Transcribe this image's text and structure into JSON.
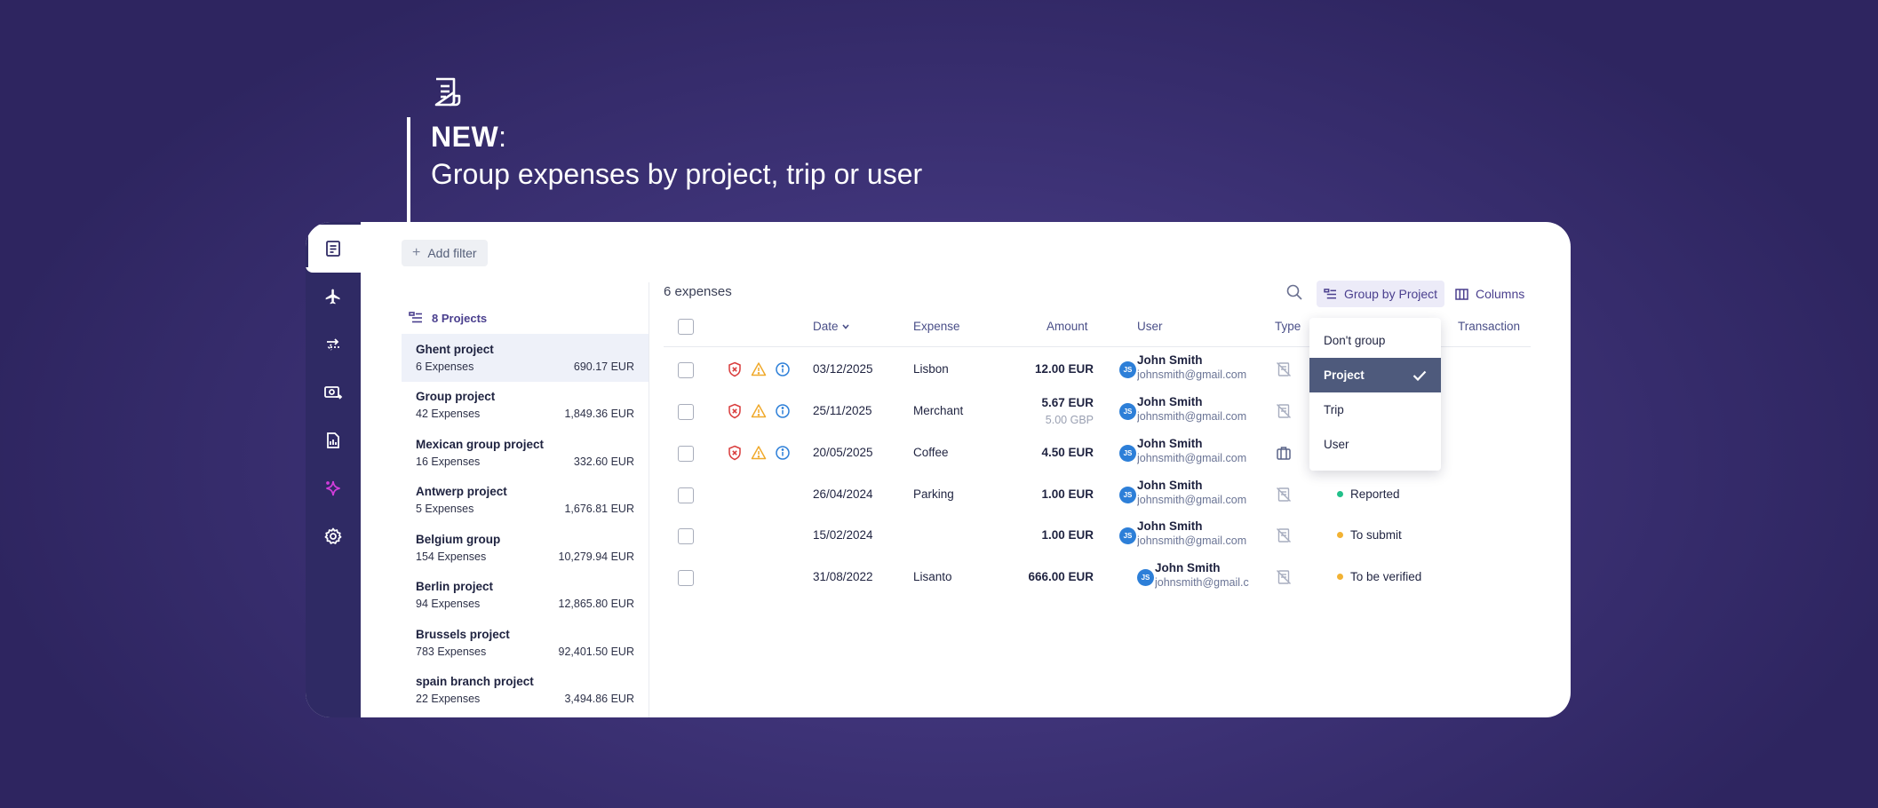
{
  "hero": {
    "new_label": "NEW",
    "colon": ":",
    "subtitle": "Group expenses by project, trip or user"
  },
  "sidebar": {
    "items": [
      "receipt-icon",
      "plane-icon",
      "transfer-icon",
      "cash-icon",
      "report-icon",
      "sparkle-icon",
      "gear-icon"
    ],
    "active": "receipt-icon"
  },
  "toolbar": {
    "add_filter": "Add filter",
    "group_by": "Group by Project",
    "columns": "Columns"
  },
  "projects": {
    "header": "8 Projects",
    "items": [
      {
        "name": "Ghent project",
        "count": "6 Expenses",
        "amount": "690.17 EUR",
        "selected": true
      },
      {
        "name": "Group project",
        "count": "42 Expenses",
        "amount": "1,849.36 EUR"
      },
      {
        "name": "Mexican group project",
        "count": "16 Expenses",
        "amount": "332.60 EUR"
      },
      {
        "name": "Antwerp project",
        "count": "5 Expenses",
        "amount": "1,676.81 EUR"
      },
      {
        "name": "Belgium group",
        "count": "154 Expenses",
        "amount": "10,279.94 EUR"
      },
      {
        "name": "Berlin project",
        "count": "94 Expenses",
        "amount": "12,865.80 EUR"
      },
      {
        "name": "Brussels project",
        "count": "783 Expenses",
        "amount": "92,401.50 EUR"
      },
      {
        "name": "spain branch project",
        "count": "22 Expenses",
        "amount": "3,494.86 EUR"
      }
    ]
  },
  "table": {
    "count_label": "6 expenses",
    "headers": {
      "date": "Date",
      "expense": "Expense",
      "amount": "Amount",
      "user": "User",
      "type": "Type",
      "transaction": "Transaction"
    },
    "rows": [
      {
        "date": "03/12/2025",
        "expense": "Lisbon",
        "amount": "12.00 EUR",
        "amount_sub": "",
        "initials": "JS",
        "user": "John Smith",
        "email": "johnsmith@gmail.com",
        "type_icon": "no-receipt-icon",
        "status": "",
        "status_color": "",
        "flags": true
      },
      {
        "date": "25/11/2025",
        "expense": "Merchant",
        "amount": "5.67 EUR",
        "amount_sub": "5.00 GBP",
        "initials": "JS",
        "user": "John Smith",
        "email": "johnsmith@gmail.com",
        "type_icon": "no-receipt-icon",
        "status": "",
        "status_color": "",
        "flags": true
      },
      {
        "date": "20/05/2025",
        "expense": "Coffee",
        "amount": "4.50 EUR",
        "amount_sub": "",
        "initials": "JS",
        "user": "John Smith",
        "email": "johnsmith@gmail.com",
        "type_icon": "briefcase-icon",
        "status": "",
        "status_color": "",
        "flags": true
      },
      {
        "date": "26/04/2024",
        "expense": "Parking",
        "amount": "1.00 EUR",
        "amount_sub": "",
        "initials": "JS",
        "user": "John Smith",
        "email": "johnsmith@gmail.com",
        "type_icon": "no-receipt-icon",
        "status": "Reported",
        "status_color": "#22c08a",
        "flags": false
      },
      {
        "date": "15/02/2024",
        "expense": "",
        "amount": "1.00 EUR",
        "amount_sub": "",
        "initials": "JS",
        "user": "John Smith",
        "email": "johnsmith@gmail.com",
        "type_icon": "no-receipt-icon",
        "status": "To submit",
        "status_color": "#f2b233",
        "flags": false
      },
      {
        "date": "31/08/2022",
        "expense": "Lisanto",
        "amount": "666.00 EUR",
        "amount_sub": "",
        "initials": "JS",
        "user": "John Smith",
        "email": "johnsmith@gmail.c",
        "type_icon": "no-receipt-icon",
        "status": "To be verified",
        "status_color": "#f2b233",
        "flags": false
      }
    ]
  },
  "group_dropdown": {
    "options": [
      "Don't group",
      "Project",
      "Trip",
      "User"
    ],
    "selected": "Project"
  },
  "colors": {
    "accent": "#4a3f8e",
    "sidebar": "#2f2a64",
    "dropdown_selected": "#4e5a7c"
  }
}
